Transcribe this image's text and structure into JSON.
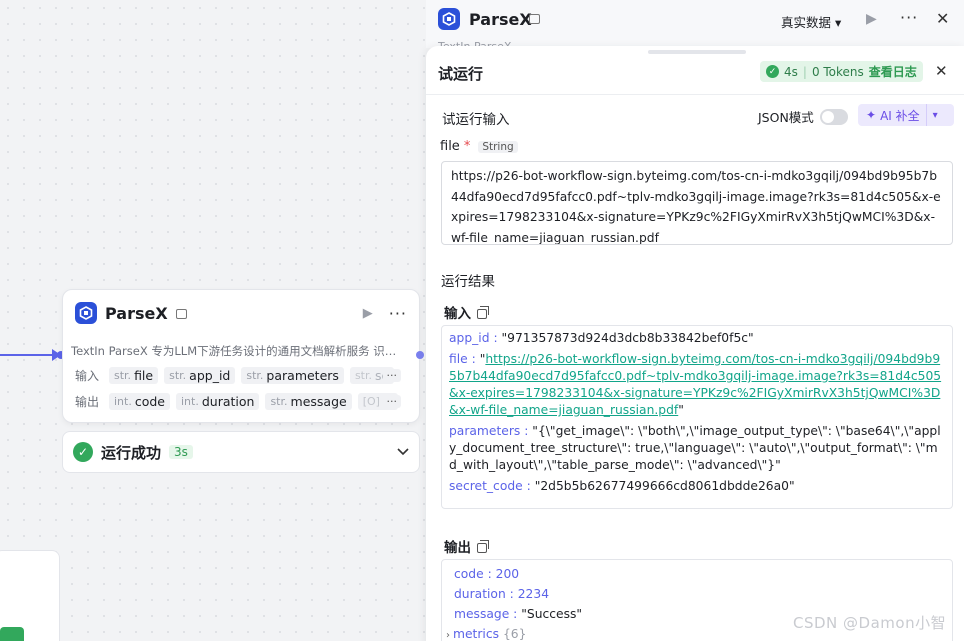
{
  "canvas": {
    "node": {
      "title": "ParseX",
      "description": "TextIn ParseX 专为LLM下游任务设计的通用文档解析服务 识别文档中的文字、表格、公式、图片等元素",
      "input_label": "输入",
      "output_label": "输出",
      "inputs": [
        {
          "type": "str.",
          "name": "file"
        },
        {
          "type": "str.",
          "name": "app_id"
        },
        {
          "type": "str.",
          "name": "parameters"
        },
        {
          "type": "str.",
          "name": "secret_code"
        }
      ],
      "outputs": [
        {
          "type": "int.",
          "name": "code"
        },
        {
          "type": "int.",
          "name": "duration"
        },
        {
          "type": "str.",
          "name": "message"
        },
        {
          "type": "[O]",
          "name": "metrics"
        }
      ],
      "more": "···"
    },
    "result": {
      "text": "运行成功",
      "time": "3s"
    }
  },
  "panel_header": {
    "title": "ParseX",
    "subtitle": "TextIn ParseX",
    "data_mode": "真实数据"
  },
  "panel": {
    "title": "试运行",
    "badge": {
      "time": "4s",
      "sep": "|",
      "tokens": "0 Tokens",
      "log": "查看日志"
    },
    "input_section": "试运行输入",
    "json_mode": "JSON模式",
    "ai_button": "AI 补全",
    "file_field": {
      "label": "file",
      "required": "*",
      "type": "String",
      "value": "https://p26-bot-workflow-sign.byteimg.com/tos-cn-i-mdko3gqilj/094bd9b95b7b44dfa90ecd7d95fafcc0.pdf~tplv-mdko3gqilj-image.image?rk3s=81d4c505&x-expires=1798233104&x-signature=YPKz9c%2FIGyXmirRvX3h5tjQwMCI%3D&x-wf-file_name=jiaguan_russian.pdf"
    },
    "result_section": "运行结果",
    "input_title": "输入",
    "input_values": {
      "app_id_key": "app_id",
      "app_id_val": "\"971357873d924d3dcb8b33842bef0f5c\"",
      "file_key": "file",
      "file_link": "https://p26-bot-workflow-sign.byteimg.com/tos-cn-i-mdko3gqilj/094bd9b95b7b44dfa90ecd7d95fafcc0.pdf~tplv-mdko3gqilj-image.image?rk3s=81d4c505&x-expires=1798233104&x-signature=YPKz9c%2FIGyXmirRvX3h5tjQwMCI%3D&x-wf-file_name=jiaguan_russian.pdf",
      "parameters_key": "parameters",
      "parameters_val": "\"{\\\"get_image\\\": \\\"both\\\",\\\"image_output_type\\\": \\\"base64\\\",\\\"apply_document_tree_structure\\\": true,\\\"language\\\": \\\"auto\\\",\\\"output_format\\\": \\\"md_with_layout\\\",\\\"table_parse_mode\\\": \\\"advanced\\\"}\"",
      "secret_key": "secret_code",
      "secret_val": "\"2d5b5b62677499666cd8061dbdde26a0\""
    },
    "output_title": "输出",
    "output_values": {
      "code_key": "code",
      "code_val": "200",
      "duration_key": "duration",
      "duration_val": "2234",
      "message_key": "message",
      "message_val": "\"Success\"",
      "metrics_key": "metrics",
      "metrics_count": "{6}"
    }
  },
  "watermark": "CSDN @Damon小智",
  "colors": {
    "accent": "#5b63e8",
    "success": "#32a85c",
    "link": "#12a58a",
    "ai": "#6a4de6"
  }
}
